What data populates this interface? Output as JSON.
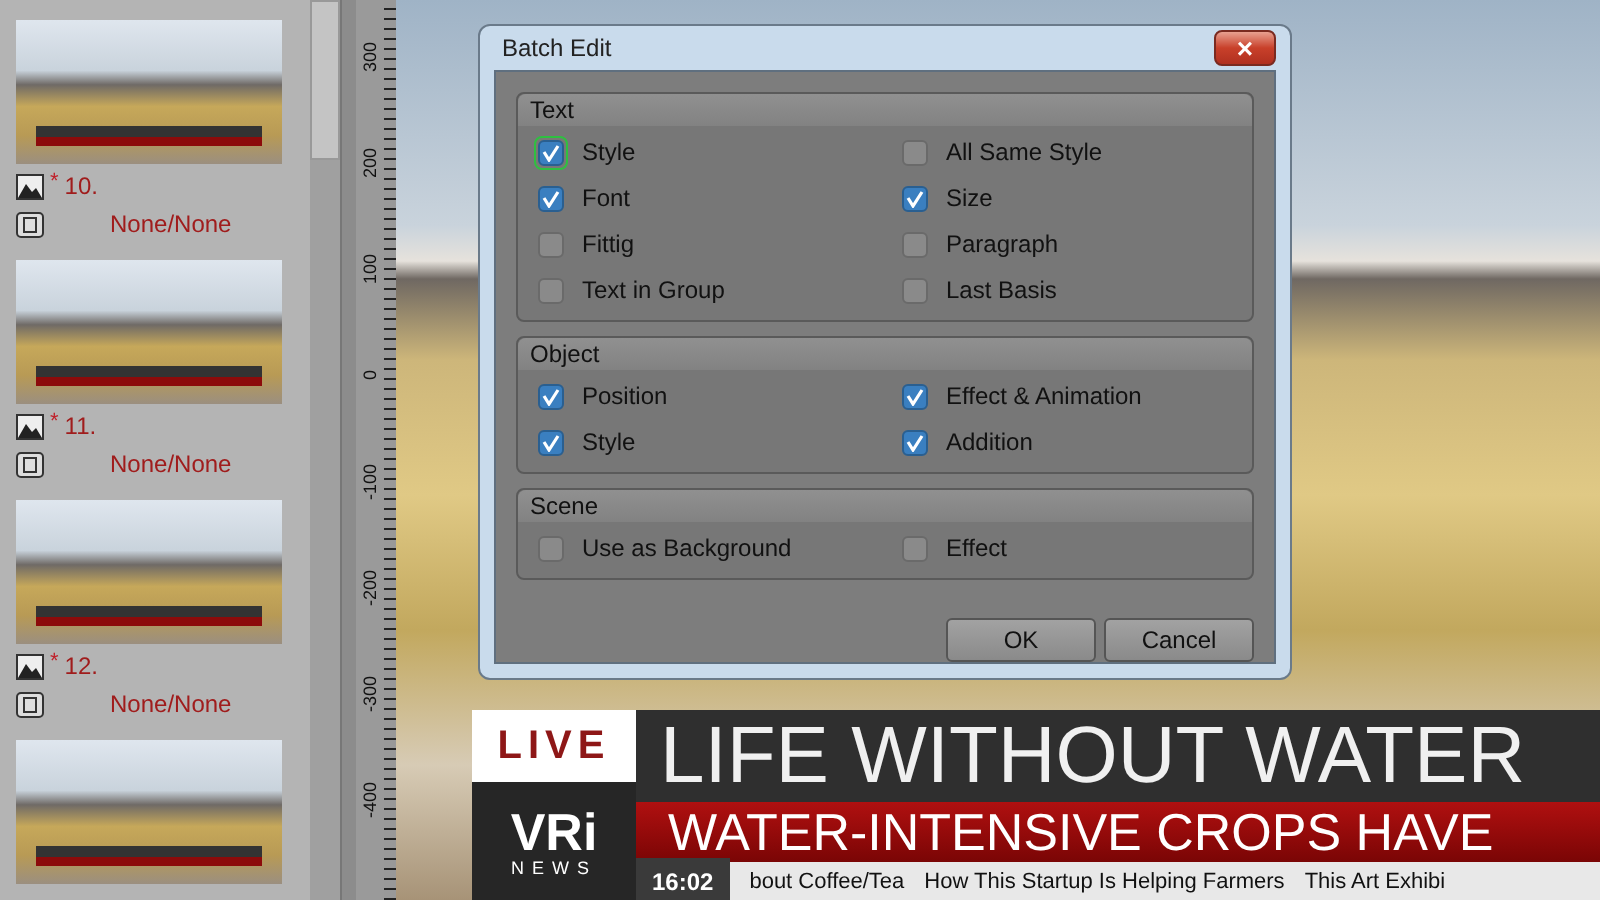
{
  "sidebar": {
    "items": [
      {
        "number": "10.",
        "marker": "*",
        "transition": "None/None"
      },
      {
        "number": "11.",
        "marker": "*",
        "transition": "None/None"
      },
      {
        "number": "12.",
        "marker": "*",
        "transition": "None/None"
      }
    ]
  },
  "ruler": {
    "labels": [
      "300",
      "200",
      "100",
      "0",
      "-100",
      "-200",
      "-300",
      "-400"
    ]
  },
  "dialog": {
    "title": "Batch Edit",
    "close": "×",
    "groups": [
      {
        "title": "Text",
        "options": [
          {
            "label": "Style",
            "checked": true,
            "focused": true
          },
          {
            "label": "All Same Style",
            "checked": false,
            "focused": false
          },
          {
            "label": "Font",
            "checked": true,
            "focused": false
          },
          {
            "label": "Size",
            "checked": true,
            "focused": false
          },
          {
            "label": "Fittig",
            "checked": false,
            "focused": false
          },
          {
            "label": "Paragraph",
            "checked": false,
            "focused": false
          },
          {
            "label": "Text in Group",
            "checked": false,
            "focused": false
          },
          {
            "label": "Last Basis",
            "checked": false,
            "focused": false
          }
        ]
      },
      {
        "title": "Object",
        "options": [
          {
            "label": "Position",
            "checked": true,
            "focused": false
          },
          {
            "label": "Effect & Animation",
            "checked": true,
            "focused": false
          },
          {
            "label": "Style",
            "checked": true,
            "focused": false
          },
          {
            "label": "Addition",
            "checked": true,
            "focused": false
          }
        ]
      },
      {
        "title": "Scene",
        "options": [
          {
            "label": "Use as Background",
            "checked": false,
            "focused": false
          },
          {
            "label": "Effect",
            "checked": false,
            "focused": false
          }
        ]
      }
    ],
    "buttons": [
      "OK",
      "Cancel"
    ]
  },
  "lower_third": {
    "live": "LIVE",
    "logo": "VRi",
    "logo_sub": "NEWS",
    "headline": "LIFE WITHOUT WATER",
    "subheadline": "WATER-INTENSIVE CROPS HAVE",
    "time": "16:02",
    "ticker": [
      "bout Coffee/Tea",
      "How This Startup Is Helping Farmers",
      "This Art Exhibi"
    ]
  }
}
